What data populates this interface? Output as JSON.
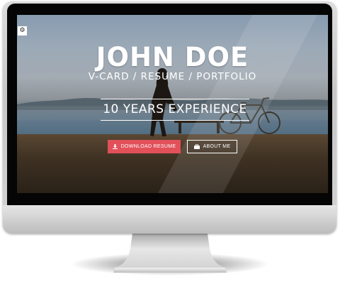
{
  "hero": {
    "name": "JOHN DOE",
    "subtitle": "V-CARD / RESUME / PORTFOLIO",
    "experience": "10 YEARS EXPERIENCE"
  },
  "buttons": {
    "download_label": "DOWNLOAD RESUME",
    "about_label": "ABOUT ME"
  },
  "icons": {
    "settings": "gear-icon",
    "download": "download-icon",
    "about": "briefcase-icon"
  },
  "colors": {
    "accent": "#e2505a",
    "text": "#ffffff",
    "bezel": "#050505",
    "monitor_frame": "#d0d0d0"
  }
}
